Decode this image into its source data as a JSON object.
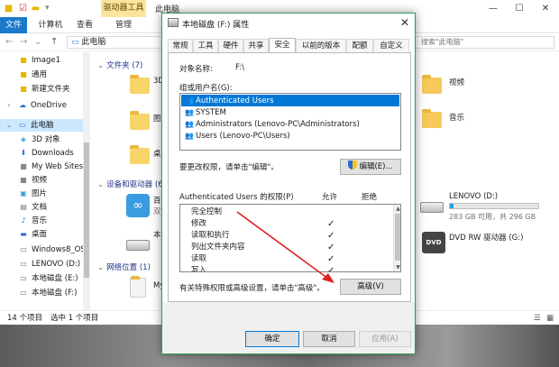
{
  "explorer": {
    "titlebar": {
      "context_tab": "驱动器工具",
      "title": "此电脑"
    },
    "ribbon": {
      "tabs": [
        "文件",
        "计算机",
        "查看",
        "管理"
      ]
    },
    "address": {
      "path": "此电脑",
      "search_placeholder": "搜索\"此电脑\""
    },
    "nav": {
      "items": [
        {
          "label": "Image1",
          "icon": "folder-icon"
        },
        {
          "label": "通用",
          "icon": "folder-icon"
        },
        {
          "label": "新建文件夹",
          "icon": "folder-icon"
        },
        {
          "label": "OneDrive",
          "icon": "cloud-icon"
        },
        {
          "label": "此电脑",
          "icon": "computer-icon"
        },
        {
          "label": "3D 对象",
          "icon": "cube-icon"
        },
        {
          "label": "Downloads",
          "icon": "download-icon"
        },
        {
          "label": "My Web Sites c",
          "icon": "folder-icon"
        },
        {
          "label": "视频",
          "icon": "video-icon"
        },
        {
          "label": "图片",
          "icon": "picture-icon"
        },
        {
          "label": "文档",
          "icon": "document-icon"
        },
        {
          "label": "音乐",
          "icon": "music-icon"
        },
        {
          "label": "桌面",
          "icon": "desktop-icon"
        },
        {
          "label": "Windows8_OS",
          "icon": "drive-icon"
        },
        {
          "label": "LENOVO (D:)",
          "icon": "drive-icon"
        },
        {
          "label": "本地磁盘 (E:)",
          "icon": "drive-icon"
        },
        {
          "label": "本地磁盘 (F:)",
          "icon": "drive-icon"
        }
      ]
    },
    "content": {
      "folders_header": "文件夹 (7)",
      "devices_header": "设备和驱动器 (6)",
      "network_header": "网络位置 (1)",
      "left_labels": [
        "3D",
        "图",
        "桌",
        "百",
        "双",
        "本",
        "My"
      ],
      "folders_right": [
        "视频",
        "音乐"
      ],
      "drive_d": {
        "name": "LENOVO (D:)",
        "space": "283 GB 可用，共 296 GB",
        "used_fraction": 0.04
      },
      "drive_g": {
        "name": "DVD RW 驱动器 (G:)",
        "icon_text": "DVD"
      }
    },
    "status": {
      "count": "14 个项目",
      "selected": "选中 1 个项目"
    }
  },
  "dialog": {
    "title": "本地磁盘 (F:) 属性",
    "tabs": [
      "常规",
      "工具",
      "硬件",
      "共享",
      "安全",
      "以前的版本",
      "配额",
      "自定义"
    ],
    "active_tab": "安全",
    "object_label": "对象名称:",
    "object_value": "F:\\",
    "group_label": "组或用户名(G):",
    "principals": [
      "Authenticated Users",
      "SYSTEM",
      "Administrators (Lenovo-PC\\Administrators)",
      "Users (Lenovo-PC\\Users)"
    ],
    "change_hint": "要更改权限，请单击\"编辑\"。",
    "edit_button": "编辑(E)...",
    "perm_for_label": "Authenticated Users 的权限(P)",
    "allow_header": "允许",
    "deny_header": "拒绝",
    "permissions": [
      {
        "name": "完全控制",
        "allow": ""
      },
      {
        "name": "修改",
        "allow": "✓"
      },
      {
        "name": "读取和执行",
        "allow": "✓"
      },
      {
        "name": "列出文件夹内容",
        "allow": "✓"
      },
      {
        "name": "读取",
        "allow": "✓"
      },
      {
        "name": "写入",
        "allow": "✓"
      }
    ],
    "advanced_hint": "有关特殊权限或高级设置，请单击\"高级\"。",
    "advanced_button": "高级(V)",
    "ok_button": "确定",
    "cancel_button": "取消",
    "apply_button": "应用(A)"
  },
  "colors": {
    "accent": "#0078d7",
    "file_tab": "#1979ca",
    "context_tab": "#fbe59a",
    "dialog_border": "#2f9e5d",
    "annotation_arrow": "#e02020"
  }
}
